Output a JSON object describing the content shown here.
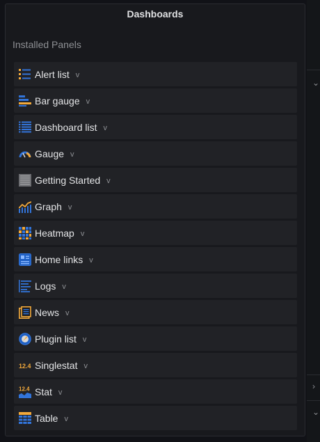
{
  "panel": {
    "title": "Dashboards",
    "section_label": "Installed Panels"
  },
  "items": [
    {
      "label": "Alert list",
      "icon": "alert-list-icon"
    },
    {
      "label": "Bar gauge",
      "icon": "bar-gauge-icon"
    },
    {
      "label": "Dashboard list",
      "icon": "dashboard-list-icon"
    },
    {
      "label": "Gauge",
      "icon": "gauge-icon"
    },
    {
      "label": "Getting Started",
      "icon": "getting-started-icon"
    },
    {
      "label": "Graph",
      "icon": "graph-icon"
    },
    {
      "label": "Heatmap",
      "icon": "heatmap-icon"
    },
    {
      "label": "Home links",
      "icon": "home-links-icon"
    },
    {
      "label": "Logs",
      "icon": "logs-icon"
    },
    {
      "label": "News",
      "icon": "news-icon"
    },
    {
      "label": "Plugin list",
      "icon": "plugin-list-icon"
    },
    {
      "label": "Singlestat",
      "icon": "singlestat-icon"
    },
    {
      "label": "Stat",
      "icon": "stat-icon"
    },
    {
      "label": "Table",
      "icon": "table-icon"
    }
  ],
  "chevron": "v",
  "rail": {
    "top_chevron": "⌄",
    "mid_chevron": "›",
    "bottom_chevron": "⌄"
  },
  "colors": {
    "accent_blue": "#3274d9",
    "accent_orange": "#f2a93b",
    "item_bg": "#212226",
    "panel_bg": "#18191d"
  }
}
